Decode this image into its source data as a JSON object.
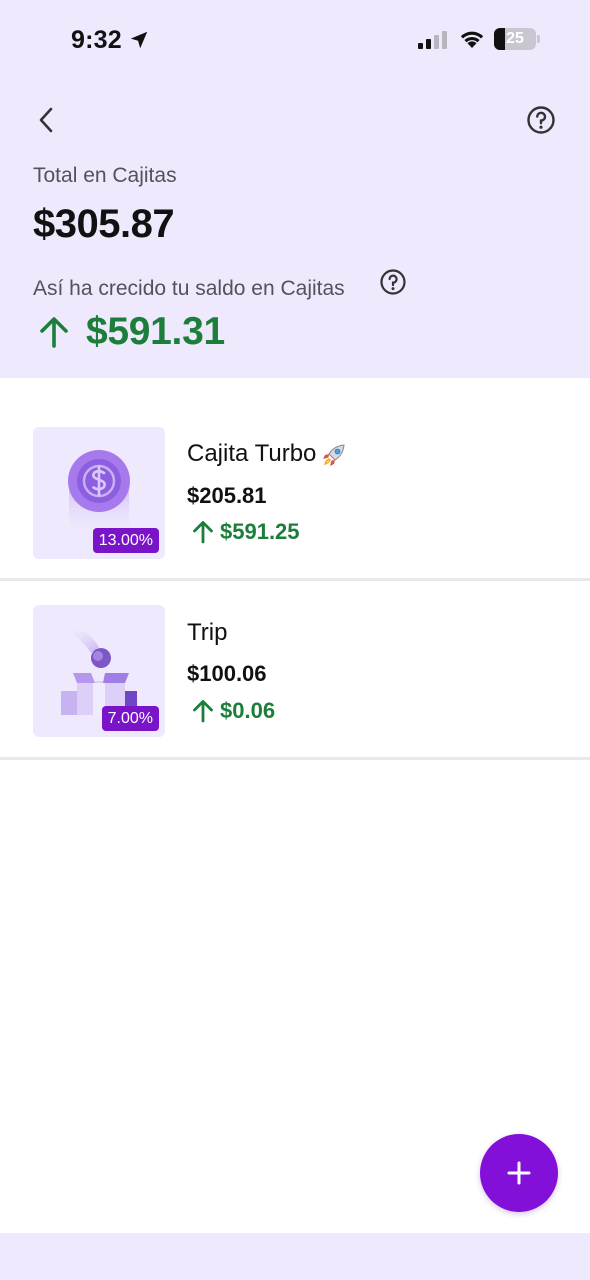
{
  "status_bar": {
    "time": "9:32",
    "battery": "25",
    "battery_level_percent": 25
  },
  "header": {
    "back_icon": "chevron-left-icon",
    "help_icon": "question-circle-icon",
    "total_label": "Total en Cajitas",
    "total_value": "$305.87",
    "growth_label": "Así ha crecido tu saldo en Cajitas",
    "growth_value": "$591.31"
  },
  "cajitas": [
    {
      "name": "Cajita Turbo",
      "emoji_icon": "rocket-icon",
      "balance": "$205.81",
      "gain": "$591.25",
      "rate": "13.00%",
      "illustration": "coin-icon"
    },
    {
      "name": "Trip",
      "balance": "$100.06",
      "gain": "$0.06",
      "rate": "7.00%",
      "illustration": "boxes-icon"
    }
  ],
  "fab": {
    "icon": "plus-icon"
  },
  "colors": {
    "header_bg": "#efe9fd",
    "accent": "#8210d8",
    "badge": "#7a14c9",
    "positive": "#1c7e3a"
  }
}
